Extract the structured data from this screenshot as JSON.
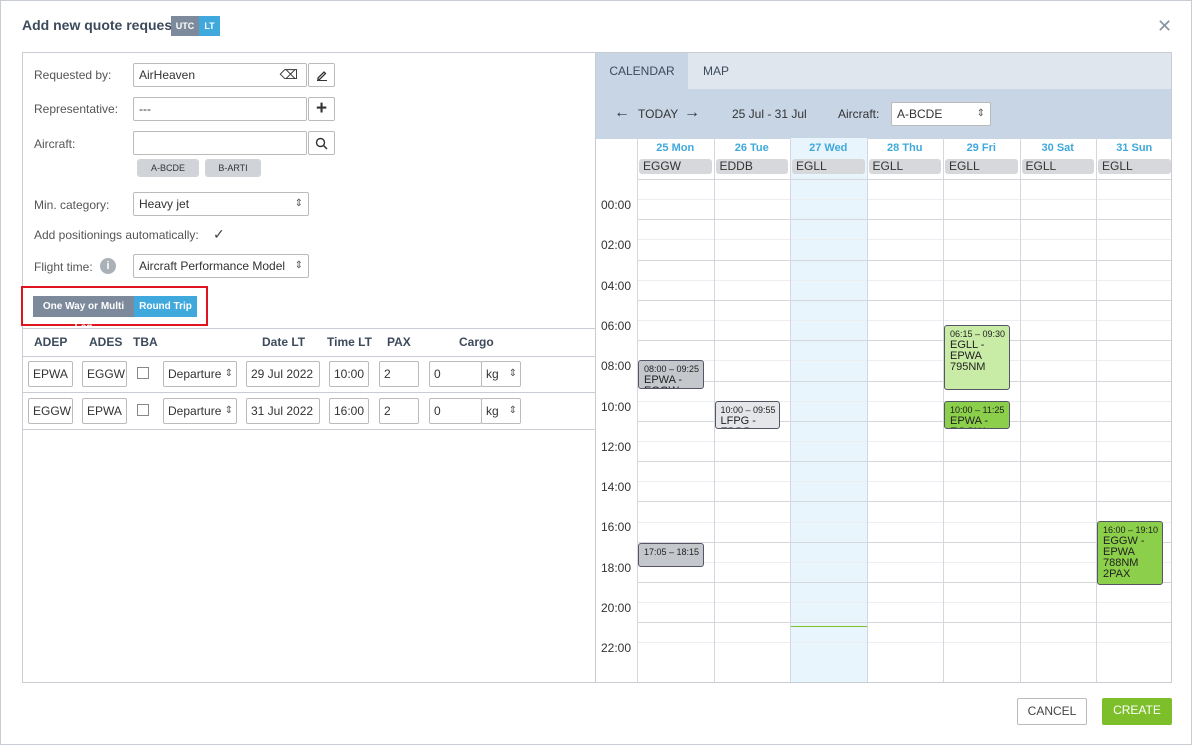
{
  "dialog": {
    "title": "Add new quote request",
    "utc_label": "UTC",
    "lt_label": "LT",
    "close_symbol": "✕"
  },
  "form": {
    "requested_by": {
      "label": "Requested by:",
      "value": "AirHeaven"
    },
    "representative": {
      "label": "Representative:",
      "value": "---"
    },
    "aircraft": {
      "label": "Aircraft:",
      "value": "",
      "chips": [
        "A-BCDE",
        "B-ARTI"
      ]
    },
    "min_category": {
      "label": "Min. category:",
      "value": "Heavy jet"
    },
    "add_positionings": {
      "label": "Add positionings automatically:",
      "checked": true
    },
    "flight_time": {
      "label": "Flight time:",
      "value": "Aircraft Performance Model"
    },
    "trip_toggle": {
      "one_way": "One Way or Multi Leg",
      "round_trip": "Round Trip",
      "selected": "Round Trip"
    }
  },
  "legs": {
    "columns": {
      "adep": "ADEP",
      "ades": "ADES",
      "tba": "TBA",
      "date": "Date LT",
      "time": "Time LT",
      "pax": "PAX",
      "cargo": "Cargo"
    },
    "rows": [
      {
        "adep": "EPWA",
        "ades": "EGGW",
        "type": "Departure",
        "date": "29 Jul 2022",
        "time": "10:00",
        "pax": "2",
        "cargo": "0",
        "unit": "kg"
      },
      {
        "adep": "EGGW",
        "ades": "EPWA",
        "type": "Departure",
        "date": "31 Jul 2022",
        "time": "16:00",
        "pax": "2",
        "cargo": "0",
        "unit": "kg"
      }
    ]
  },
  "calendar": {
    "tabs": [
      "CALENDAR",
      "MAP"
    ],
    "active_tab": "CALENDAR",
    "today_label": "TODAY",
    "range": "25 Jul - 31 Jul",
    "aircraft_label": "Aircraft:",
    "aircraft_value": "A-BCDE",
    "days": [
      {
        "label": "25 Mon",
        "airport": "EGGW"
      },
      {
        "label": "26 Tue",
        "airport": "EDDB"
      },
      {
        "label": "27 Wed",
        "airport": "EGLL"
      },
      {
        "label": "28 Thu",
        "airport": "EGLL"
      },
      {
        "label": "29 Fri",
        "airport": "EGLL"
      },
      {
        "label": "30 Sat",
        "airport": "EGLL"
      },
      {
        "label": "31 Sun",
        "airport": "EGLL"
      }
    ],
    "hours": [
      "00:00",
      "02:00",
      "04:00",
      "06:00",
      "08:00",
      "10:00",
      "12:00",
      "14:00",
      "16:00",
      "18:00",
      "20:00",
      "22:00"
    ],
    "events": [
      {
        "day": 0,
        "start": 8.0,
        "end": 9.42,
        "time": "08:00 – 09:25",
        "text": "EPWA - EGGW",
        "color": "#c4c7cb"
      },
      {
        "day": 0,
        "start": 17.08,
        "end": 18.25,
        "time": "17:05 – 18:15",
        "text": "",
        "color": "#c4c7cb"
      },
      {
        "day": 1,
        "start": 10.0,
        "end": 11.4,
        "time": "10:00 – 09:55",
        "text": "LFPG - EDDB",
        "color": "#e4e6e9"
      },
      {
        "day": 4,
        "start": 6.25,
        "end": 9.5,
        "time": "06:15 – 09:30",
        "text": "EGLL - EPWA 795NM",
        "color": "#c8eba5"
      },
      {
        "day": 4,
        "start": 10.0,
        "end": 11.42,
        "time": "10:00 – 11:25",
        "text": "EPWA - EGGW",
        "color": "#8bcf4a"
      },
      {
        "day": 6,
        "start": 16.0,
        "end": 19.17,
        "time": "16:00 – 19:10",
        "text": "EGGW - EPWA 788NM 2PAX",
        "color": "#8bcf4a"
      }
    ]
  },
  "footer": {
    "cancel": "CANCEL",
    "create": "CREATE"
  },
  "colors": {
    "accent": "#3fa9dd",
    "create": "#7cbf2a",
    "toggle_inactive": "#7d8a9b",
    "highlight_box": "#e0141e",
    "today_column": "#e9f5fc"
  }
}
